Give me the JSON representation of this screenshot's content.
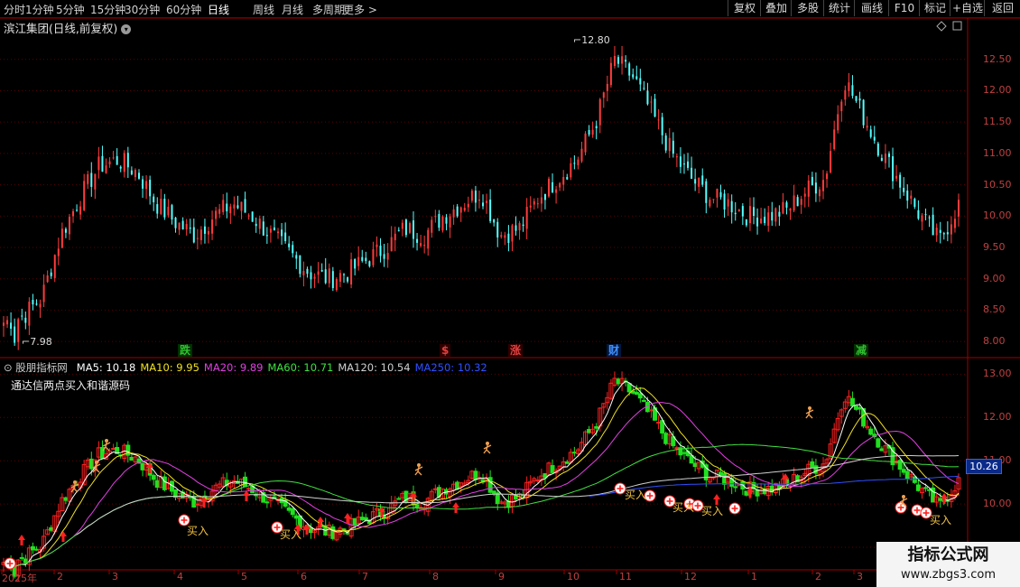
{
  "toolbar": {
    "periods": [
      "分时",
      "1分钟",
      "5分钟",
      "15分钟",
      "30分钟",
      "60分钟",
      "日线",
      "周线",
      "月线",
      "多周期",
      "更多 >"
    ],
    "active": "日线",
    "right": [
      "复权",
      "叠加",
      "多股",
      "统计",
      "画线",
      "F10",
      "标记",
      "+自选",
      "返回"
    ]
  },
  "main": {
    "title": "滨江集团(日线,前复权)",
    "max_label": "12.80",
    "min_label": "7.98",
    "y_ticks": [
      "12.50",
      "12.00",
      "11.50",
      "11.00",
      "10.50",
      "10.00",
      "9.50",
      "9.00",
      "8.50",
      "8.00"
    ],
    "events": [
      {
        "text": "跌",
        "color": "#30c030",
        "bg": "#003000"
      },
      {
        "text": "$",
        "color": "#e04040",
        "bg": "#300000"
      },
      {
        "text": "涨",
        "color": "#e04040",
        "bg": "#300000"
      },
      {
        "text": "财",
        "color": "#4090ff",
        "bg": "#001840"
      },
      {
        "text": "减",
        "color": "#30c030",
        "bg": "#003000"
      }
    ]
  },
  "indicator": {
    "name": "股朋指标网",
    "ma": [
      {
        "label": "MA5: 10.18",
        "color": "#ffffff"
      },
      {
        "label": "MA10: 9.95",
        "color": "#f0e020"
      },
      {
        "label": "MA20: 9.89",
        "color": "#e040e0"
      },
      {
        "label": "MA60: 10.71",
        "color": "#40e040"
      },
      {
        "label": "MA120: 10.54",
        "color": "#d0d0d0"
      },
      {
        "label": "MA250: 10.32",
        "color": "#3050ff"
      }
    ],
    "subtitle": "通达信两点买入和谐源码",
    "y_ticks": [
      "13.00",
      "12.00",
      "11.00",
      "10.00",
      "9.00"
    ],
    "last_price": "10.26",
    "buy_label": "买入"
  },
  "x_axis": [
    "2025年",
    "2",
    "3",
    "4",
    "5",
    "6",
    "7",
    "8",
    "9",
    "10",
    "11",
    "12",
    "1",
    "2",
    "3"
  ],
  "watermark": {
    "title": "指标公式网",
    "url": "www.zbgs3.com"
  },
  "colors": {
    "up": "#ff3b3b",
    "down": "#54ffff",
    "ind_up": "#ff2020",
    "ind_down": "#20e020",
    "grid": "#5a0000",
    "axis": "#a00000"
  },
  "chart_data": {
    "type": "candlestick",
    "title": "滨江集团(日线,前复权)",
    "max_price": 12.8,
    "min_price": 7.98,
    "last_price": 10.26,
    "ylim_main": [
      7.8,
      12.9
    ],
    "ylim_indicator": [
      8.5,
      13.3
    ],
    "ma_last": {
      "MA5": 10.18,
      "MA10": 9.95,
      "MA20": 9.89,
      "MA60": 10.71,
      "MA120": 10.54,
      "MA250": 10.32
    },
    "close_path_approx": [
      8.3,
      8.4,
      8.7,
      9.7,
      10.3,
      10.8,
      10.9,
      10.7,
      10.2,
      9.9,
      9.7,
      10.0,
      10.2,
      10.0,
      9.7,
      9.4,
      9.1,
      9.0,
      9.1,
      9.3,
      9.5,
      9.8,
      9.7,
      10.0,
      10.2,
      10.4,
      9.7,
      9.8,
      10.3,
      10.6,
      10.9,
      11.5,
      12.5,
      12.2,
      11.6,
      11.0,
      10.6,
      10.3,
      10.2,
      10.0,
      10.0,
      10.1,
      10.4,
      10.6,
      12.2,
      11.6,
      11.0,
      10.5,
      10.0,
      9.6,
      10.2
    ]
  }
}
